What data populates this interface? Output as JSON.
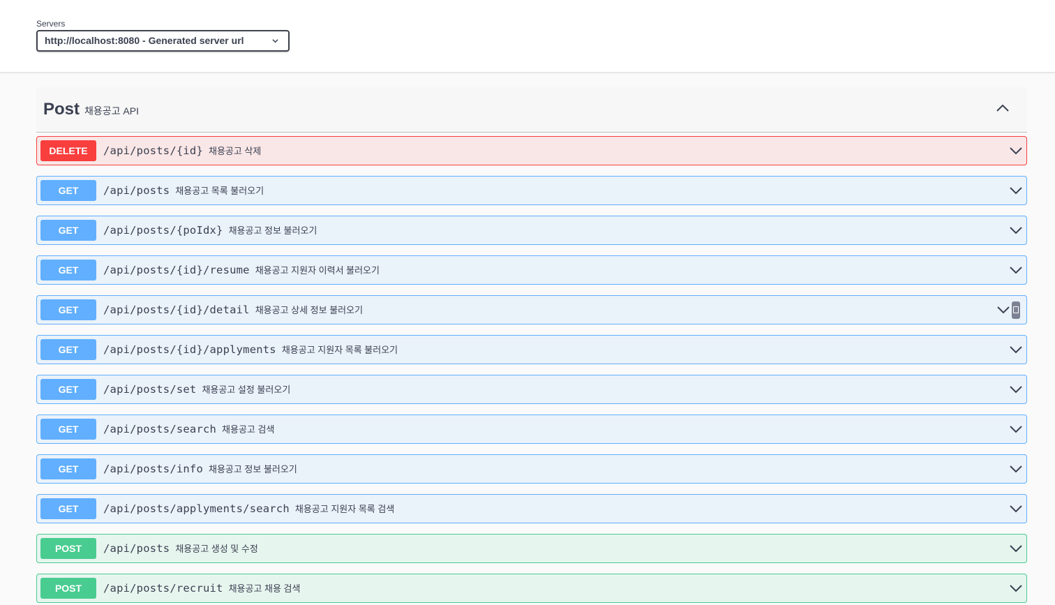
{
  "servers": {
    "label": "Servers",
    "selected": "http://localhost:8080 - Generated server url"
  },
  "tag": {
    "name": "Post",
    "description": "채용공고 API"
  },
  "operations": [
    {
      "method": "DELETE",
      "path": "/api/posts/{id}",
      "summary": "채용공고 삭제"
    },
    {
      "method": "GET",
      "path": "/api/posts",
      "summary": "채용공고 목록 불러오기"
    },
    {
      "method": "GET",
      "path": "/api/posts/{poIdx}",
      "summary": "채용공고 정보 불러오기"
    },
    {
      "method": "GET",
      "path": "/api/posts/{id}/resume",
      "summary": "채용공고 지원자 이력서 불러오기"
    },
    {
      "method": "GET",
      "path": "/api/posts/{id}/detail",
      "summary": "채용공고 상세 정보 불러오기"
    },
    {
      "method": "GET",
      "path": "/api/posts/{id}/applyments",
      "summary": "채용공고 지원자 목록 불러오기"
    },
    {
      "method": "GET",
      "path": "/api/posts/set",
      "summary": "채용공고 설정 불러오기"
    },
    {
      "method": "GET",
      "path": "/api/posts/search",
      "summary": "채용공고 검색"
    },
    {
      "method": "GET",
      "path": "/api/posts/info",
      "summary": "채용공고 정보 불러오기"
    },
    {
      "method": "GET",
      "path": "/api/posts/applyments/search",
      "summary": "채용공고 지원자 목록 검색"
    },
    {
      "method": "POST",
      "path": "/api/posts",
      "summary": "채용공고 생성 및 수정"
    },
    {
      "method": "POST",
      "path": "/api/posts/recruit",
      "summary": "채용공고 채용 검색"
    }
  ],
  "icons": {
    "server_dropdown": "chevron-down-icon",
    "tag_toggle": "chevron-up-icon",
    "op_expand": "chevron-down-icon",
    "copy": "copy-icon"
  },
  "colors": {
    "delete": "#f93e3e",
    "get": "#61affe",
    "post": "#49cc90"
  }
}
